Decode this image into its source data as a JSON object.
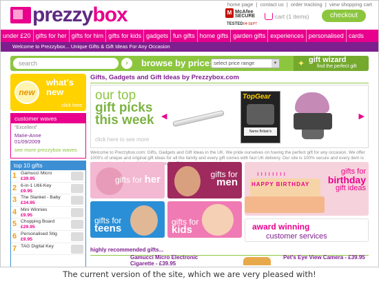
{
  "header": {
    "logo_part1": "prezzy",
    "logo_part2": "box",
    "top_links": [
      "home page",
      "contact us",
      "order tracking",
      "view shopping cart"
    ],
    "top_links_sep": "|",
    "security": {
      "brand": "McAfee",
      "label": "SECURE",
      "tested": "TESTED",
      "date": "04-SEPT"
    },
    "cart_text": "cart",
    "cart_count": "(1 items)",
    "checkout_label": "checkout"
  },
  "nav": {
    "items": [
      "under £20",
      "gifts for her",
      "gifts for him",
      "gifts for kids",
      "gadgets",
      "fun gifts",
      "home gifts",
      "garden gifts",
      "experiences",
      "personalised",
      "cards"
    ]
  },
  "welcome_text": "Welcome to Prezzybox... Unique Gifts & Gift Ideas For Any Occasion",
  "search": {
    "placeholder": "search",
    "browse_label": "browse by price:",
    "price_select": "select price range",
    "wizard_title": "gift wizard",
    "wizard_sub": "find the perfect gift"
  },
  "whats_new": {
    "badge": "new",
    "title_line1": "what's",
    "title_line2": "new",
    "link": "click here"
  },
  "customer_waves": {
    "title": "customer waves",
    "quote": "\"Excellent\"",
    "name": "Marie-Anne",
    "date": "01/09/2009",
    "link": "see more prezzybox waves"
  },
  "top10": {
    "title": "top 10 gifts",
    "items": [
      {
        "num": "1",
        "name": "Gamucci Micro",
        "sub": "Cigarette",
        "price": "£39.95"
      },
      {
        "num": "2",
        "name": "6-in-1 Utili-Key",
        "sub": "",
        "price": "£9.95"
      },
      {
        "num": "3",
        "name": "The Slanket - Baby",
        "sub": "Wine",
        "price": "£34.95"
      },
      {
        "num": "4",
        "name": "Mini Winnies",
        "sub": "",
        "price": "£9.95"
      },
      {
        "num": "5",
        "name": "Chopping Board",
        "sub": "Index",
        "price": "£29.95"
      },
      {
        "num": "6",
        "name": "Personalised Stig",
        "sub": "Poster",
        "price": "£9.95"
      },
      {
        "num": "7",
        "name": "TAG Digital Key",
        "sub": "",
        "price": ""
      }
    ]
  },
  "main": {
    "title": "Gifts, Gadgets and Gift Ideas by Prezzybox.com",
    "picks_line1": "our top",
    "picks_line2": "gift picks",
    "picks_line3": "this week",
    "picks_more": "click here to see more",
    "magazine_title": "TopGear",
    "magazine_band": "Name Britain's",
    "intro": "Welcome to Prezzybox.com: Gifts, Gadgets and Gift Ideas in the UK. We pride ourselves on having the perfect gift for any occasion. We offer 1000's of unique and original gift ideas for all the family and every gift comes with fast UK delivery. Our site is 100% secure and every item is protected by our \"no quibble\" returns policy. Enjoy...",
    "tiles": {
      "her": {
        "prefix": "gifts for",
        "word": "her"
      },
      "men": {
        "prefix": "gifts for",
        "word": "men"
      },
      "teens": {
        "prefix": "gifts for",
        "word": "teens"
      },
      "kids": {
        "prefix": "gifts for",
        "word": "kids"
      }
    },
    "birthday": {
      "letters": "HAPPY BIRTHDAY",
      "line1": "gifts for",
      "line2": "birthday",
      "line3": "gift ideas"
    },
    "award": {
      "line1": "award winning",
      "line2": "customer services"
    },
    "recommended_title": "highly recommended gifts...",
    "rec1_name": "Gamucci Micro Electronic",
    "rec1_sub": "Cigarette - £39.95",
    "rec2": "Pet's Eye View Camera - £39.95"
  },
  "caption": "The current version of the site, which we are very pleased with!",
  "colors": {
    "pink": "#e9008c",
    "purple": "#7d1f8e",
    "green": "#8cc63f",
    "blue": "#3d8fd4",
    "yellow": "#ffd200"
  }
}
